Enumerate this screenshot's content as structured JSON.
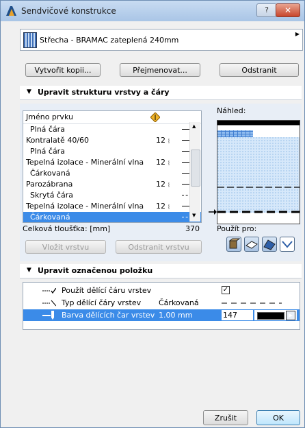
{
  "window": {
    "title": "Sendvičové konstrukce",
    "help_label": "?",
    "close_label": "✕"
  },
  "selector": {
    "current": "Střecha - BRAMAC zateplená 240mm",
    "arrow": "▶"
  },
  "actions": {
    "copy": "Vytvořit kopii...",
    "rename": "Přejmenovat...",
    "delete": "Odstranit"
  },
  "structure_section": {
    "title": "Upravit strukturu vrstvy a čáry",
    "column_name": "Jméno prvku",
    "rows": [
      {
        "name": "Plná čára",
        "thickness": "",
        "hatch": "",
        "line": "solid",
        "sub": true
      },
      {
        "name": "Kontralatě 40/60",
        "thickness": "12",
        "hatch": "⦚",
        "line": "solid",
        "sub": false
      },
      {
        "name": "Plná čára",
        "thickness": "",
        "hatch": "",
        "line": "solid",
        "sub": true
      },
      {
        "name": "Tepelná izolace - Minerální vlna",
        "thickness": "12",
        "hatch": "⦚",
        "line": "solid",
        "sub": false
      },
      {
        "name": "Čárkovaná",
        "thickness": "",
        "hatch": "",
        "line": "solid",
        "sub": true
      },
      {
        "name": "Parozábrana",
        "thickness": "12",
        "hatch": "⦚",
        "line": "solid",
        "sub": false
      },
      {
        "name": "Skrytá čára",
        "thickness": "",
        "hatch": "",
        "line": "dashed",
        "sub": true
      },
      {
        "name": "Tepelná izolace - Minerální vlna",
        "thickness": "12",
        "hatch": "⦚",
        "line": "solid",
        "sub": false
      },
      {
        "name": "Čárkovaná",
        "thickness": "",
        "hatch": "",
        "line": "dashed",
        "sub": true,
        "selected": true
      }
    ],
    "total_label": "Celková tloušťka: [mm]",
    "total_value": "370",
    "preview_label": "Náhled:",
    "use_for_label": "Použít pro:",
    "insert_layer": "Vložit vrstvu",
    "delete_layer": "Odstranit vrstvu"
  },
  "item_section": {
    "title": "Upravit označenou položku",
    "rows": [
      {
        "label": "Použít dělící čáru vrstev",
        "value": "",
        "right": "✓"
      },
      {
        "label": "Typ dělící čáry vrstev",
        "value": "Čárkovaná",
        "right": "dashed"
      },
      {
        "label": "Barva dělících čar vrstev",
        "value": "1.00 mm",
        "right": "147",
        "selected": true
      }
    ]
  },
  "footer": {
    "cancel": "Zrušit",
    "ok": "OK"
  },
  "colors": {
    "selection": "#3b8be8",
    "preview_hatch": "#cfe3f7"
  }
}
